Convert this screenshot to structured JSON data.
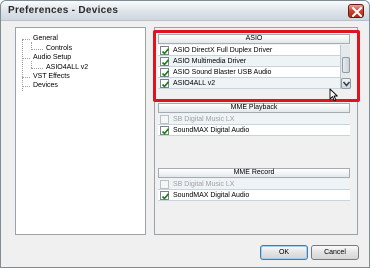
{
  "window": {
    "title": "Preferences - Devices",
    "close_icon": "close-icon"
  },
  "tree": {
    "items": [
      {
        "label": "General"
      },
      {
        "label": "Controls"
      },
      {
        "label": "Audio Setup"
      },
      {
        "label": "ASIO4ALL v2"
      },
      {
        "label": "VST Effects"
      },
      {
        "label": "Devices"
      }
    ]
  },
  "asio": {
    "header": "ASIO",
    "rows": [
      {
        "label": "ASIO DirectX Full Duplex Driver",
        "checked": true
      },
      {
        "label": "ASIO Multimedia Driver",
        "checked": true
      },
      {
        "label": "ASIO Sound Blaster USB Audio",
        "checked": true
      },
      {
        "label": "ASIO4ALL v2",
        "checked": true
      }
    ]
  },
  "mme_playback": {
    "header": "MME Playback",
    "rows": [
      {
        "label": "SB Digital Music LX",
        "checked": false,
        "disabled": true
      },
      {
        "label": "SoundMAX Digital Audio",
        "checked": true,
        "disabled": false
      }
    ]
  },
  "mme_record": {
    "header": "MME Record",
    "rows": [
      {
        "label": "SB Digital Music LX",
        "checked": false,
        "disabled": true
      },
      {
        "label": "SoundMAX Digital Audio",
        "checked": true,
        "disabled": false
      }
    ]
  },
  "buttons": {
    "ok": "OK",
    "cancel": "Cancel"
  },
  "colors": {
    "highlight_frame": "#e0141e",
    "check": "#1a7a12"
  }
}
